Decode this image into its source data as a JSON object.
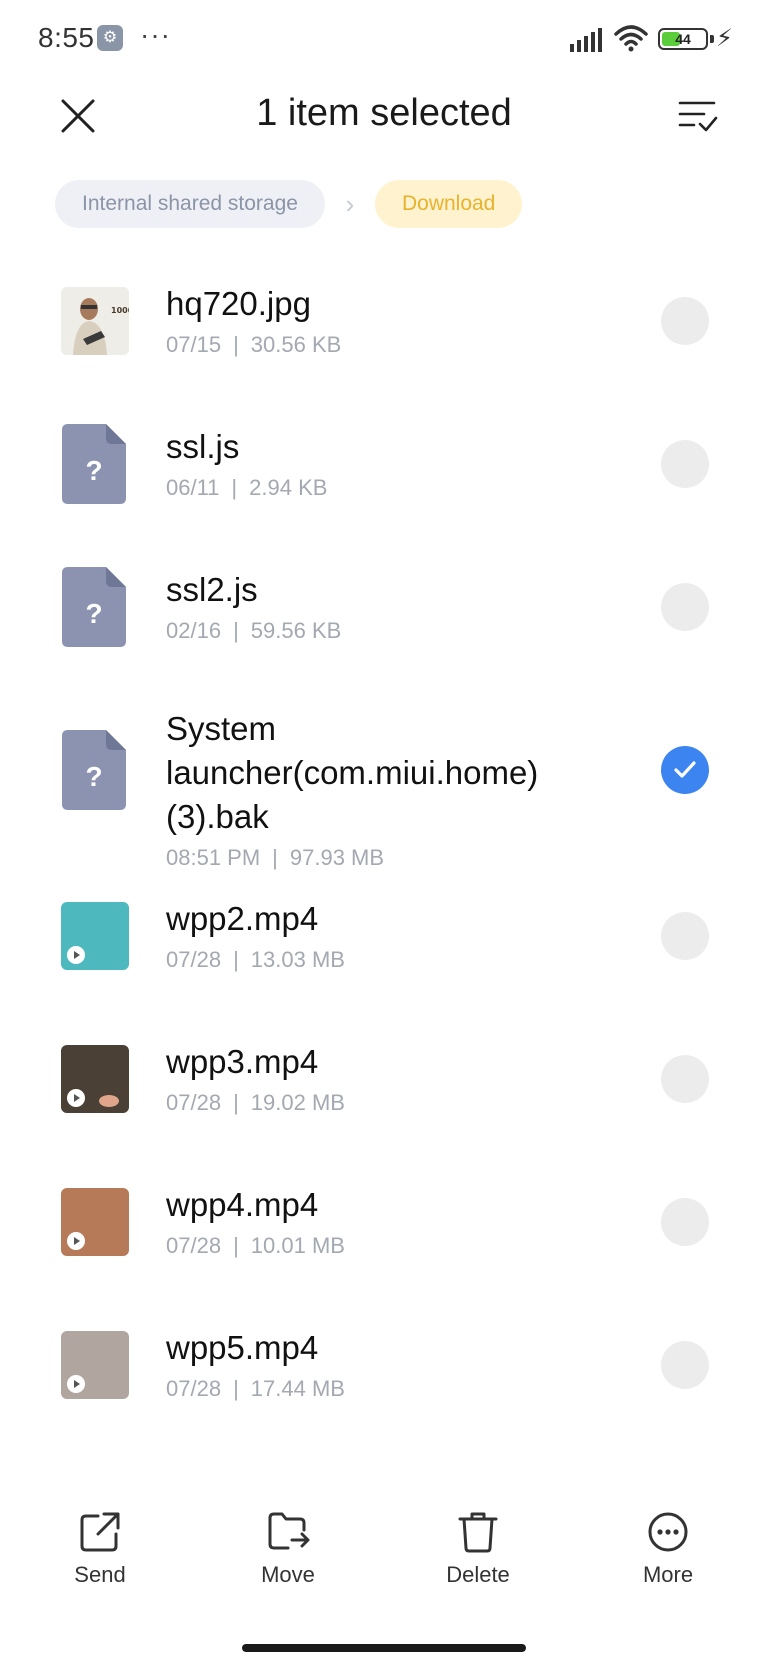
{
  "status_bar": {
    "time": "8:55",
    "more_indicator": "···",
    "battery_level": "44",
    "battery_fraction": 0.44
  },
  "header": {
    "title": "1 item selected"
  },
  "breadcrumb": {
    "root": "Internal shared storage",
    "current": "Download"
  },
  "files": [
    {
      "name": "hq720.jpg",
      "date": "07/15",
      "size": "30.56 KB",
      "thumb": "photo",
      "selected": false
    },
    {
      "name": "ssl.js",
      "date": "06/11",
      "size": "2.94 KB",
      "thumb": "unknown",
      "selected": false
    },
    {
      "name": "ssl2.js",
      "date": "02/16",
      "size": "59.56 KB",
      "thumb": "unknown",
      "selected": false
    },
    {
      "name": "System launcher(com.miui.home) (3).bak",
      "date": "08:51 PM",
      "size": "97.93 MB",
      "thumb": "unknown",
      "selected": true
    },
    {
      "name": "wpp2.mp4",
      "date": "07/28",
      "size": "13.03 MB",
      "thumb": "video",
      "thumb_color": "#4db8be",
      "selected": false
    },
    {
      "name": "wpp3.mp4",
      "date": "07/28",
      "size": "19.02 MB",
      "thumb": "video",
      "thumb_color": "#4a4036",
      "selected": false
    },
    {
      "name": "wpp4.mp4",
      "date": "07/28",
      "size": "10.01 MB",
      "thumb": "video",
      "thumb_color": "#b67a58",
      "selected": false
    },
    {
      "name": "wpp5.mp4",
      "date": "07/28",
      "size": "17.44 MB",
      "thumb": "video",
      "thumb_color": "#b1a59f",
      "selected": false
    }
  ],
  "toolbar": {
    "send": "Send",
    "move": "Move",
    "delete": "Delete",
    "more": "More"
  },
  "colors": {
    "accent": "#3c84ef",
    "breadcrumb_current_bg": "#fff3cf",
    "breadcrumb_current_text": "#e8b22d",
    "unknown_file_icon": "#8b93b0"
  }
}
